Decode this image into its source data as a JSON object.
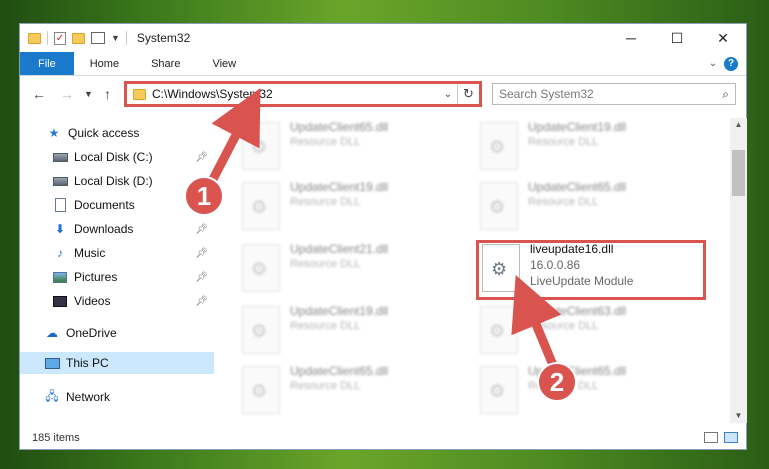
{
  "window": {
    "title": "System32",
    "controls": {
      "minimize": "─",
      "maximize": "☐",
      "close": "✕"
    }
  },
  "ribbon": {
    "tabs": [
      {
        "label": "File"
      },
      {
        "label": "Home"
      },
      {
        "label": "Share"
      },
      {
        "label": "View"
      }
    ],
    "help": "?"
  },
  "nav": {
    "address": "C:\\Windows\\System32",
    "search_placeholder": "Search System32"
  },
  "sidebar": {
    "items": [
      {
        "label": "Quick access",
        "icon": "star-icon"
      },
      {
        "label": "Local Disk (C:)",
        "icon": "drive-icon",
        "pinned": true
      },
      {
        "label": "Local Disk (D:)",
        "icon": "drive-icon"
      },
      {
        "label": "Documents",
        "icon": "document-icon"
      },
      {
        "label": "Downloads",
        "icon": "download-icon",
        "pinned": true
      },
      {
        "label": "Music",
        "icon": "music-icon",
        "pinned": true
      },
      {
        "label": "Pictures",
        "icon": "picture-icon",
        "pinned": true
      },
      {
        "label": "Videos",
        "icon": "video-icon",
        "pinned": true
      },
      {
        "label": "OneDrive",
        "icon": "cloud-icon"
      },
      {
        "label": "This PC",
        "icon": "computer-icon",
        "selected": true
      },
      {
        "label": "Network",
        "icon": "network-icon"
      }
    ]
  },
  "files": [
    {
      "name": "UpdateClient65.dll",
      "type": "Resource DLL"
    },
    {
      "name": "UpdateClient19.dll",
      "type": "Resource DLL"
    },
    {
      "name": "UpdateClient19.dll",
      "type": "Resource DLL"
    },
    {
      "name": "UpdateClient65.dll",
      "type": "Resource DLL"
    },
    {
      "name": "UpdateClient21.dll",
      "type": "Resource DLL"
    },
    {
      "name": "liveupdate16.dll",
      "version": "16.0.0.86",
      "type": "LiveUpdate Module"
    },
    {
      "name": "UpdateClient19.dll",
      "type": "Resource DLL"
    },
    {
      "name": "UpdateClient63.dll",
      "type": "Resource DLL"
    },
    {
      "name": "UpdateClient65.dll",
      "type": "Resource DLL"
    },
    {
      "name": "UpdateClient65.dll",
      "type": "Resource DLL"
    }
  ],
  "status": {
    "item_count": "185 items"
  },
  "annotations": [
    {
      "number": "1"
    },
    {
      "number": "2"
    }
  ],
  "colors": {
    "accent": "#1979ca",
    "highlight": "#d9534f",
    "selected": "#cce8ff"
  }
}
